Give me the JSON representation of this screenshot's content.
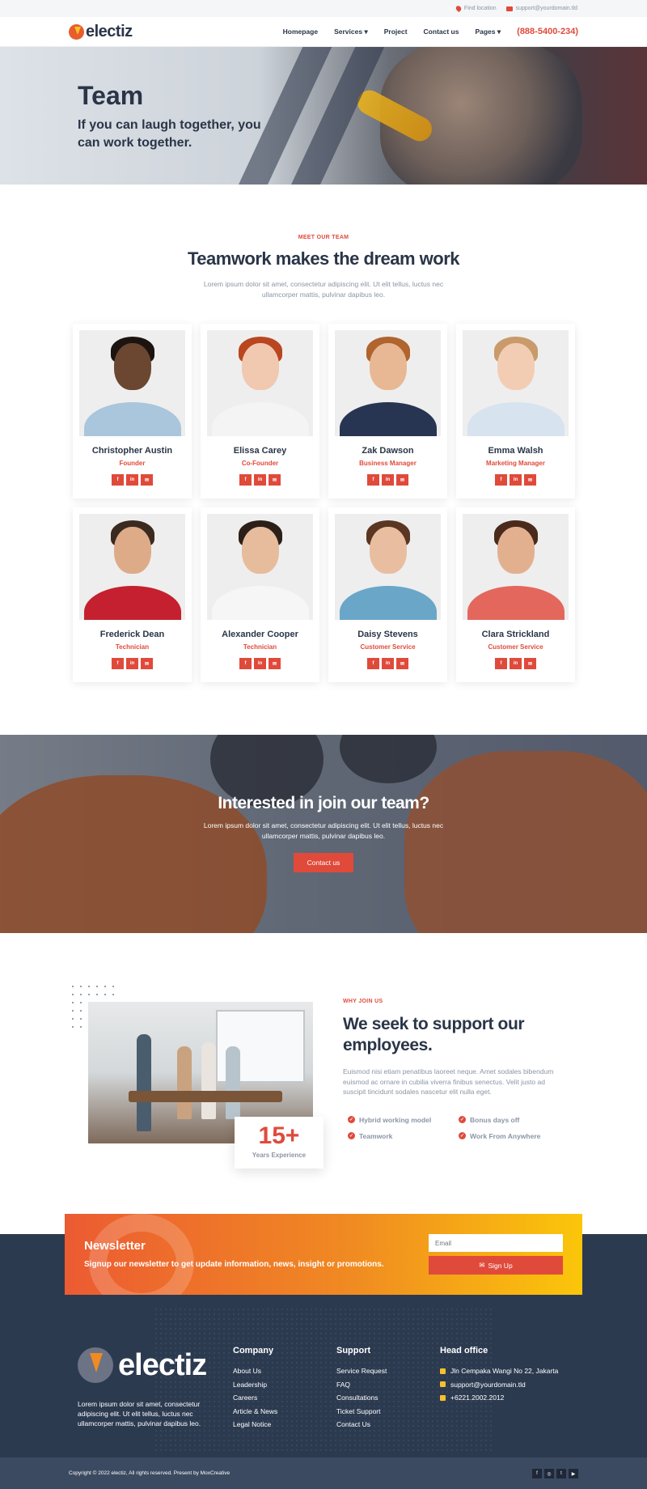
{
  "topbar": {
    "location": "Find location",
    "email": "support@yourdomain.tld"
  },
  "header": {
    "logo": "electiz",
    "nav": [
      "Homepage",
      "Services",
      "Project",
      "Contact us",
      "Pages"
    ],
    "phone": "(888-5400-234)"
  },
  "hero": {
    "title": "Team",
    "subtitle": "If you can laugh together, you can work together."
  },
  "team": {
    "eyebrow": "MEET OUR TEAM",
    "title": "Teamwork makes the dream work",
    "description": "Lorem ipsum dolor sit amet, consectetur adipiscing elit. Ut elit tellus, luctus nec ullamcorper mattis, pulvinar dapibus leo.",
    "members": [
      {
        "name": "Christopher Austin",
        "role": "Founder"
      },
      {
        "name": "Elissa Carey",
        "role": "Co-Founder"
      },
      {
        "name": "Zak Dawson",
        "role": "Business Manager"
      },
      {
        "name": "Emma Walsh",
        "role": "Marketing Manager"
      },
      {
        "name": "Frederick Dean",
        "role": "Technician"
      },
      {
        "name": "Alexander Cooper",
        "role": "Technician"
      },
      {
        "name": "Daisy Stevens",
        "role": "Customer Service"
      },
      {
        "name": "Clara Strickland",
        "role": "Customer Service"
      }
    ],
    "social_icons": [
      "f",
      "in",
      "✉"
    ]
  },
  "cta": {
    "title": "Interested in join our team?",
    "description": "Lorem ipsum dolor sit amet, consectetur adipiscing elit. Ut elit tellus, luctus nec ullamcorper mattis, pulvinar dapibus leo.",
    "button": "Contact us"
  },
  "why": {
    "eyebrow": "WHY JOIN US",
    "title": "We seek to support our employees.",
    "description": "Euismod nisi etiam penatibus laoreet neque. Amet sodales bibendum euismod ac ornare in cubilia viverra finibus senectus. Velit justo ad suscipit tincidunt sodales nascetur elit nulla eget.",
    "benefits": [
      "Hybrid working model",
      "Bonus days off",
      "Teamwork",
      "Work From Anywhere"
    ],
    "stat_value": "15+",
    "stat_label": "Years Experience"
  },
  "newsletter": {
    "title": "Newsletter",
    "subtitle": "Signup our newsletter to get update information, news, insight or promotions.",
    "placeholder": "Email",
    "button": "Sign Up"
  },
  "footer": {
    "logo": "electiz",
    "description": "Lorem ipsum dolor sit amet, consectetur adipiscing elit. Ut elit tellus, luctus nec ullamcorper mattis, pulvinar dapibus leo.",
    "company": {
      "title": "Company",
      "links": [
        "About Us",
        "Leadership",
        "Careers",
        "Article & News",
        "Legal Notice"
      ]
    },
    "support": {
      "title": "Support",
      "links": [
        "Service Request",
        "FAQ",
        "Consultations",
        "Ticket Support",
        "Contact Us"
      ]
    },
    "office": {
      "title": "Head office",
      "address": "Jln Cempaka Wangi No 22, Jakarta",
      "email": "support@yourdomain.tld",
      "phone": "+6221.2002.2012"
    },
    "copyright": "Copyright © 2022 electiz, All rights reserved. Present by MoxCreative",
    "social_icons": [
      "f",
      "◎",
      "t",
      "▶"
    ]
  },
  "colors": {
    "accent": "#e04a3b",
    "navy": "#2c3a50",
    "text": "#2a3547",
    "muted": "#8b95a5"
  }
}
